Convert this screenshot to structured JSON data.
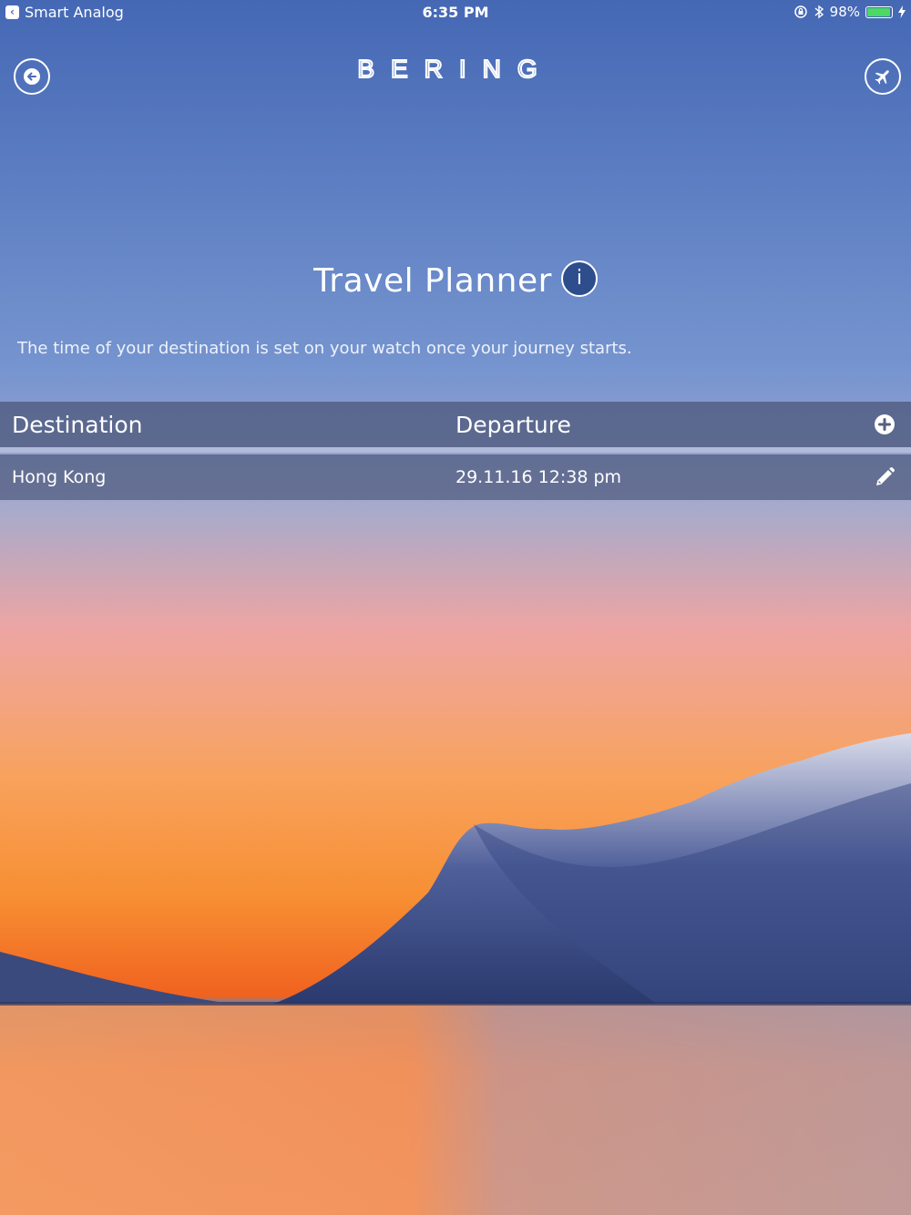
{
  "status_bar": {
    "back_app": "Smart Analog",
    "time": "6:35 PM",
    "battery": "98%"
  },
  "header": {
    "brand": "BERING"
  },
  "main": {
    "title": "Travel Planner",
    "info_label": "i",
    "description": "The time of your destination is set on your watch once your journey starts."
  },
  "table": {
    "columns": [
      "Destination",
      "Departure"
    ],
    "rows": [
      {
        "destination": "Hong Kong",
        "departure": "29.11.16 12:38 pm"
      }
    ]
  },
  "icons": {
    "back": "arrow-left-icon",
    "plane": "airplane-icon",
    "add": "plus-circle-icon",
    "edit": "pencil-icon",
    "lock": "orientation-lock-icon",
    "bluetooth": "bluetooth-icon"
  },
  "colors": {
    "battery_fill": "#4cd964",
    "sky_top": "#4568b5",
    "horizon": "#f0621f"
  }
}
